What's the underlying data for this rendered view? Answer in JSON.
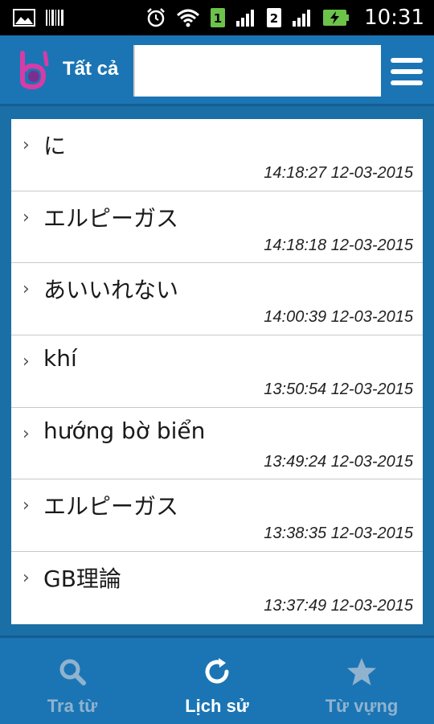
{
  "status_bar": {
    "time": "10:31",
    "sim1": "1",
    "sim2": "2",
    "icons": [
      "image-icon",
      "barcode-icon",
      "alarm-icon",
      "wifi-icon",
      "sim1-icon",
      "signal-icon",
      "sim2-icon",
      "signal-icon",
      "battery-charging-icon"
    ]
  },
  "header": {
    "scope_label": "Tất cả",
    "search_value": "",
    "logo_icon": "app-logo-icon",
    "menu_icon": "hamburger-menu-icon"
  },
  "history": {
    "items": [
      {
        "term": "に",
        "time": "14:18:27 12-03-2015"
      },
      {
        "term": "エルピーガス",
        "time": "14:18:18 12-03-2015"
      },
      {
        "term": "あいいれない",
        "time": "14:00:39 12-03-2015"
      },
      {
        "term": "khí",
        "time": "13:50:54 12-03-2015"
      },
      {
        "term": "hướng bờ biển",
        "time": "13:49:24 12-03-2015"
      },
      {
        "term": "エルピーガス",
        "time": "13:38:35 12-03-2015"
      },
      {
        "term": "GB理論",
        "time": "13:37:49 12-03-2015"
      }
    ],
    "chevron": "›"
  },
  "bottom_nav": {
    "tabs": [
      {
        "label": "Tra từ",
        "icon": "search-icon",
        "active": false
      },
      {
        "label": "Lịch sử",
        "icon": "history-refresh-icon",
        "active": true
      },
      {
        "label": "Từ vựng",
        "icon": "star-icon",
        "active": false
      }
    ]
  },
  "colors": {
    "primary": "#1b75b4",
    "background": "#1a6fa6",
    "inactive_label": "#8fb3cf",
    "logo_pink": "#d63ca6"
  }
}
